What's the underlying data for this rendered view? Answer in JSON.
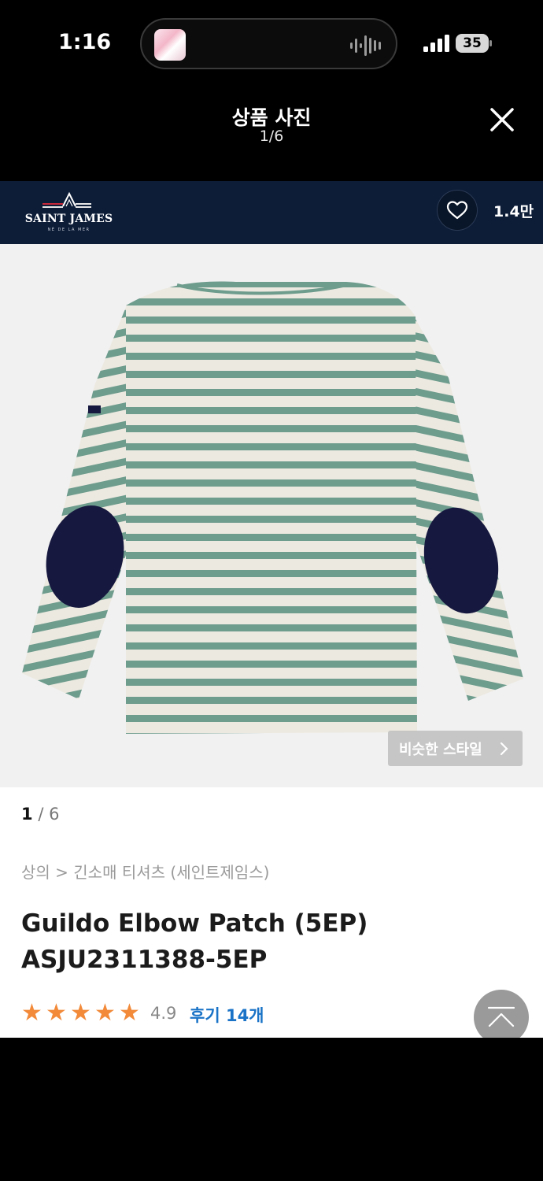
{
  "status_bar": {
    "time": "1:16",
    "battery": "35"
  },
  "viewer": {
    "title": "상품 사진",
    "counter": "1/6"
  },
  "brand": {
    "name": "SAINT JAMES",
    "tagline": "NÉ DE LA MER",
    "like_count": "1.4만"
  },
  "image": {
    "similar_style_label": "비슷한 스타일",
    "stripe_color": "#6e9c8d",
    "base_color": "#ece9e0",
    "patch_color": "#17183f"
  },
  "product": {
    "page_current": "1",
    "page_total": "6",
    "breadcrumb": "상의 > 긴소매 티셔츠 (세인트제임스)",
    "name": "Guildo Elbow Patch (5EP) ASJU2311388-5EP",
    "stars": [
      "★",
      "★",
      "★",
      "★",
      "★"
    ],
    "rating": "4.9",
    "review_label": "후기 14개"
  },
  "icons": [
    "close-icon",
    "heart-icon",
    "chevron-right-icon",
    "arrow-up-icon",
    "signal-icon",
    "battery-icon",
    "waveform-icon"
  ]
}
